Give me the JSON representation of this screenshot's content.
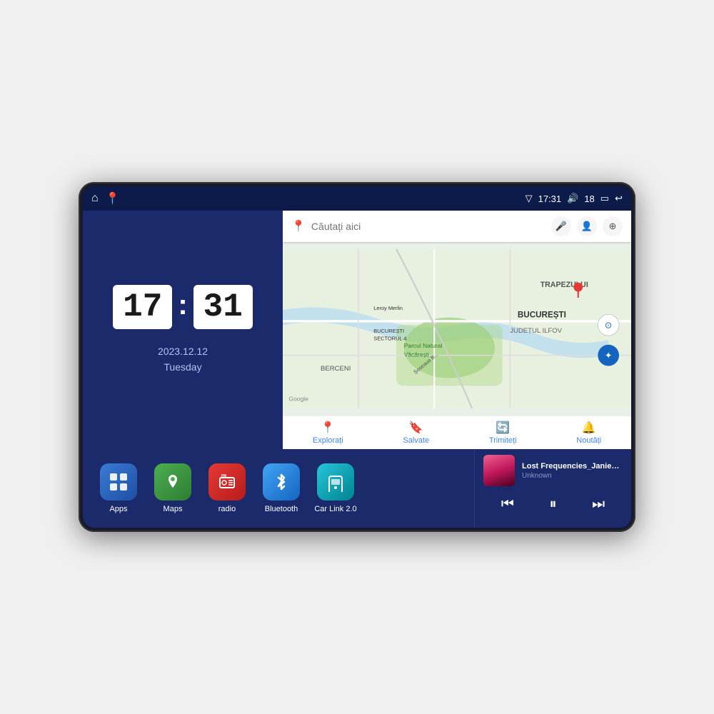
{
  "device": {
    "status_bar": {
      "left_icons": [
        "home-icon",
        "maps-pin-icon"
      ],
      "time": "17:31",
      "signal_icon": "▽",
      "volume_icon": "🔊",
      "battery_level": "18",
      "battery_icon": "🔋",
      "back_icon": "↩"
    },
    "clock": {
      "hour": "17",
      "minute": "31",
      "date": "2023.12.12",
      "day": "Tuesday"
    },
    "map": {
      "search_placeholder": "Căutați aici",
      "footer_items": [
        {
          "label": "Explorați",
          "icon": "📍"
        },
        {
          "label": "Salvate",
          "icon": "🔖"
        },
        {
          "label": "Trimiteți",
          "icon": "🔄"
        },
        {
          "label": "Noutăți",
          "icon": "🔔"
        }
      ],
      "labels": [
        "TRAPEZULUI",
        "BUCUREȘTI",
        "JUDEȚUL ILFOV",
        "BERCENI",
        "Parcul Natural Văcărești",
        "Leroy Merlin",
        "BUCUREȘTI SECTORUL 4"
      ]
    },
    "apps": [
      {
        "id": "apps",
        "label": "Apps",
        "icon": "⊞",
        "class": "app-apps"
      },
      {
        "id": "maps",
        "label": "Maps",
        "icon": "📍",
        "class": "app-maps"
      },
      {
        "id": "radio",
        "label": "radio",
        "icon": "📻",
        "class": "app-radio"
      },
      {
        "id": "bluetooth",
        "label": "Bluetooth",
        "icon": "⚡",
        "class": "app-bt"
      },
      {
        "id": "carlink",
        "label": "Car Link 2.0",
        "icon": "📱",
        "class": "app-carlink"
      }
    ],
    "music": {
      "title": "Lost Frequencies_Janieck Devy-...",
      "artist": "Unknown",
      "controls": {
        "prev": "⏮",
        "play_pause": "⏸",
        "next": "⏭"
      }
    }
  }
}
